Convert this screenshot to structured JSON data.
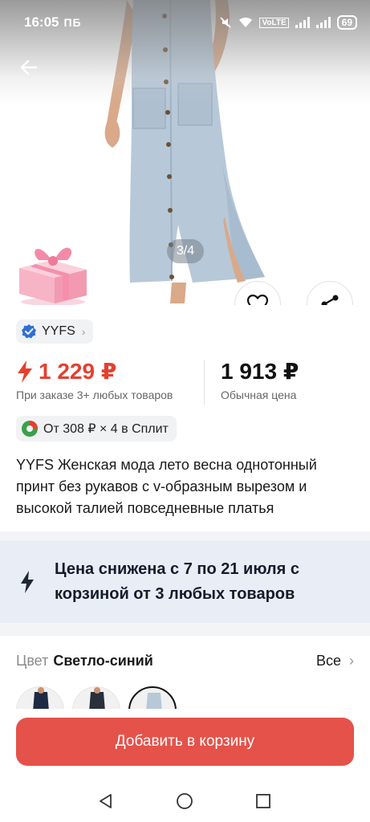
{
  "status_bar": {
    "time": "16:05",
    "left_extra": "ПБ",
    "volte": "VoLTE",
    "battery": "69"
  },
  "gallery": {
    "counter": "3/4"
  },
  "seller": {
    "name": "YYFS"
  },
  "price": {
    "sale": "1 229 ₽",
    "sale_note": "При заказе 3+ любых товаров",
    "regular": "1 913 ₽",
    "regular_note": "Обычная цена"
  },
  "split": {
    "label": "От 308 ₽ × 4 в Сплит"
  },
  "product": {
    "title": "YYFS Женская мода лето весна однотонный принт без рукавов с v-образным вырезом и высокой талией повседневные платья"
  },
  "promo": {
    "text": "Цена снижена с 7 по 21 июля с корзиной от 3 любых товаров"
  },
  "color": {
    "label": "Цвет",
    "value": "Светло-синий",
    "all_label": "Все"
  },
  "cta": {
    "label": "Добавить в корзину"
  },
  "colors": {
    "accent_red": "#e4524a",
    "price_red": "#e4402f",
    "promo_bg": "#e8edf6",
    "verified_blue": "#2f6fd6"
  },
  "icons": [
    "back-arrow-icon",
    "heart-icon",
    "share-icon",
    "lightning-icon",
    "verified-badge-icon",
    "split-logo-icon",
    "chevron-right-icon",
    "gift-icon",
    "nav-back-icon",
    "nav-home-icon",
    "nav-recents-icon"
  ]
}
